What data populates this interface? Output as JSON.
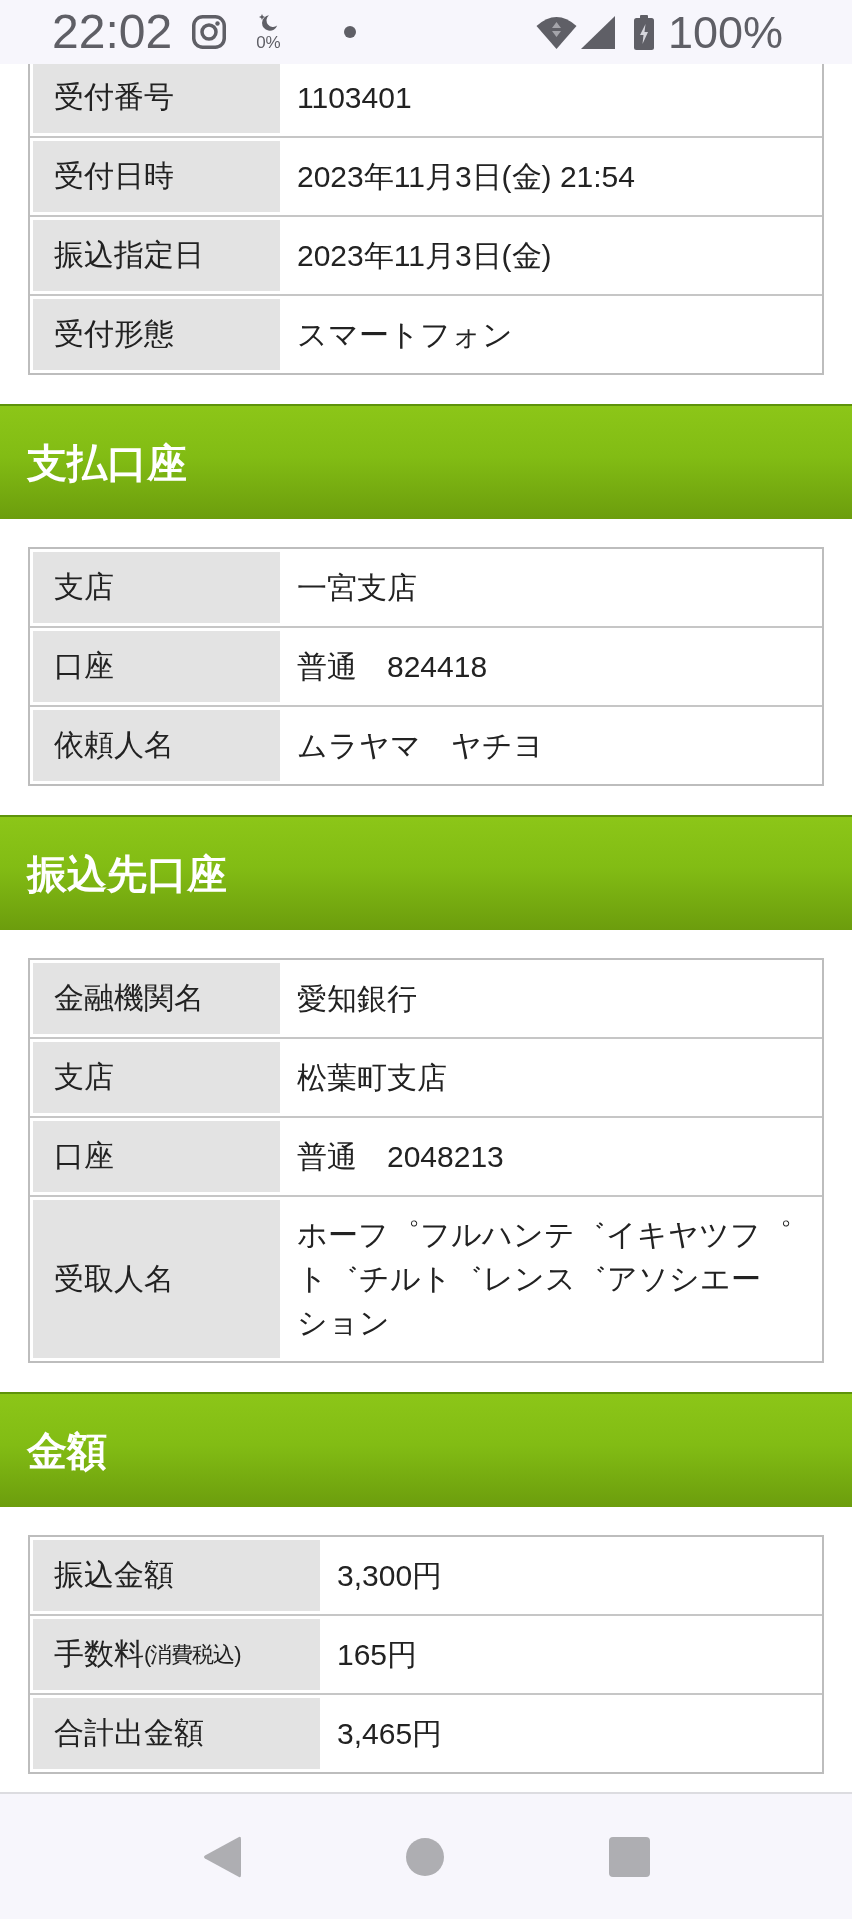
{
  "status_bar": {
    "time": "22:02",
    "indicator_label": "0%",
    "battery_label": "100%"
  },
  "sections": [
    {
      "kind": "details",
      "rows": [
        {
          "label": "受付番号",
          "value": "1103401"
        },
        {
          "label": "受付日時",
          "value": "2023年11月3日(金) 21:54"
        },
        {
          "label": "振込指定日",
          "value": "2023年11月3日(金)"
        },
        {
          "label": "受付形態",
          "value": "スマートフォン"
        }
      ]
    },
    {
      "kind": "details",
      "title": "支払口座",
      "rows": [
        {
          "label": "支店",
          "value": "一宮支店"
        },
        {
          "label": "口座",
          "value": "普通　824418"
        },
        {
          "label": "依頼人名",
          "value": "ムラヤマ　ヤチヨ"
        }
      ]
    },
    {
      "kind": "details",
      "title": "振込先口座",
      "rows": [
        {
          "label": "金融機関名",
          "value": "愛知銀行"
        },
        {
          "label": "支店",
          "value": "松葉町支店"
        },
        {
          "label": "口座",
          "value": "普通　2048213"
        },
        {
          "label": "受取人名",
          "value": "ホーフ゜フルハンテ゛イキヤツフ゜ト゛チルト゛レンス゛アソシエーション"
        }
      ]
    },
    {
      "kind": "amount",
      "title": "金額",
      "rows": [
        {
          "label": "振込金額",
          "value": "3,300円"
        },
        {
          "label": "手数料",
          "label_note": "(消費税込)",
          "value": "165円"
        },
        {
          "label": "合計出金額",
          "value": "3,465円"
        }
      ]
    }
  ]
}
